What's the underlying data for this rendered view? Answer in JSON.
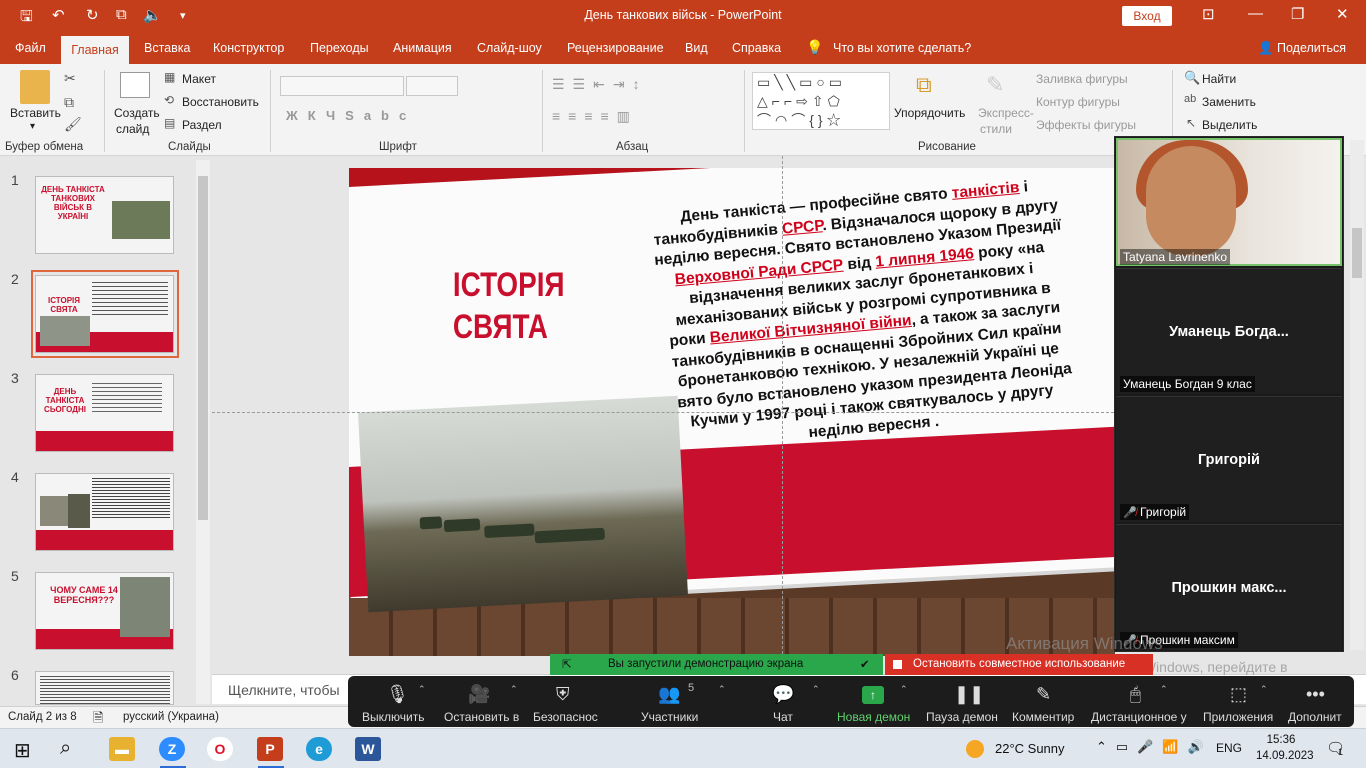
{
  "window": {
    "title": "День танкових військ  -  PowerPoint",
    "signin": "Вход"
  },
  "tabs": [
    "Файл",
    "Главная",
    "Вставка",
    "Конструктор",
    "Переходы",
    "Анимация",
    "Слайд-шоу",
    "Рецензирование",
    "Вид",
    "Справка",
    "Что вы хотите сделать?",
    "Поделиться"
  ],
  "ribbon": {
    "paste": "Вставить",
    "clipboard_group": "Буфер обмена",
    "new_slide": [
      "Создать",
      "слайд"
    ],
    "layout": "Макет",
    "reset": "Восстановить",
    "section": "Раздел",
    "slides_group": "Слайды",
    "font_group": "Шрифт",
    "paragraph_group": "Абзац",
    "arrange": "Упорядочить",
    "quick_styles": [
      "Экспресс-",
      "стили"
    ],
    "shape_fill": "Заливка фигуры",
    "shape_outline": "Контур фигуры",
    "shape_effects": "Эффекты фигуры",
    "drawing_group": "Рисование",
    "find": "Найти",
    "replace": "Заменить",
    "select": "Выделить"
  },
  "thumbnails": [
    {
      "num": "1",
      "title": "ДЕНЬ ТАНКІСТА ТАНКОВИХ ВІЙСЬК В УКРАЇНІ"
    },
    {
      "num": "2",
      "title": "ІСТОРІЯ СВЯТА"
    },
    {
      "num": "3",
      "title": "ДЕНЬ ТАНКІСТА СЬОГОДНІ"
    },
    {
      "num": "4",
      "title": ""
    },
    {
      "num": "5",
      "title": "ЧОМУ САМЕ 14 ВЕРЕСНЯ???"
    },
    {
      "num": "6",
      "title": ""
    }
  ],
  "slide": {
    "heading": "ІСТОРІЯ СВЯТА",
    "body_parts": [
      {
        "t": "День танкіста — професійне свято ",
        "l": false
      },
      {
        "t": "танкістів",
        "l": true
      },
      {
        "t": " і танкобудівників ",
        "l": false
      },
      {
        "t": "СРСР",
        "l": true
      },
      {
        "t": ". Відзначалося щороку в другу неділю вересня. Свято встановлено Указом Президії ",
        "l": false
      },
      {
        "t": "Верховної Ради СРСР",
        "l": true
      },
      {
        "t": " від ",
        "l": false
      },
      {
        "t": "1 липня 1946",
        "l": true
      },
      {
        "t": " року «на відзначення великих заслуг бронетанкових і механізованих військ у розгромі супротивника в роки ",
        "l": false
      },
      {
        "t": "Великої Вітчизняної війни",
        "l": true
      },
      {
        "t": ", а також за заслуги танкобудівників в оснащенні Збройних Сил країни бронетанковою технікою. У незалежній Україні це свято було встановлено указом президента Леоніда Кучми у 1997 році і також святкувалось у другу неділю вересня .",
        "l": false
      }
    ]
  },
  "notes": "Щелкните, чтобы",
  "status": {
    "slide": "Слайд 2 из 8",
    "language": "русский (Украина)"
  },
  "zoom": {
    "participants": [
      {
        "display": "",
        "label": "Tatyana Lavrinenko",
        "muted": false
      },
      {
        "display": "Уманець  Богда...",
        "label": "Уманець Богдан 9 клас",
        "muted": false
      },
      {
        "display": "Григорій",
        "label": "Григорій",
        "muted": true
      },
      {
        "display": "Прошкин  макс...",
        "label": "Прошкин максим",
        "muted": true
      }
    ],
    "share_notice": "Вы запустили демонстрацию экрана",
    "stop_share": "Остановить совместное использование",
    "participant_count": "5",
    "toolbar": [
      "Выключить",
      "Остановить в",
      "Безопаснос",
      "Участники",
      "Чат",
      "Новая демон",
      "Пауза демон",
      "Комментир",
      "Дистанционное у",
      "Приложения",
      "Дополнит"
    ]
  },
  "watermark": {
    "line1": "Активация Windows",
    "line2": "Чтобы активировать Windows, перейдите в раздел \"Параметры\"."
  },
  "taskbar": {
    "weather": "22°C  Sunny",
    "lang": "ENG",
    "time": "15:36",
    "date": "14.09.2023",
    "notifications": "1"
  }
}
